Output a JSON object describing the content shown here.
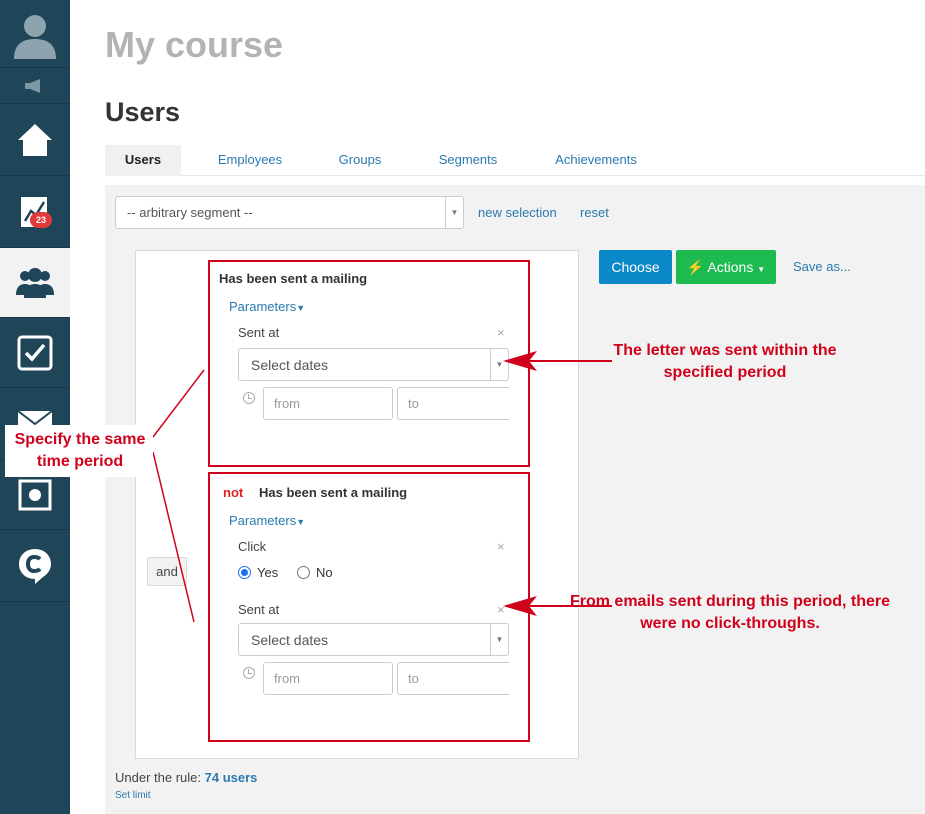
{
  "app": {
    "course_title": "My course",
    "page_title": "Users"
  },
  "sidebar": {
    "items": [
      {
        "icon": "user-avatar-icon"
      },
      {
        "icon": "megaphone-icon"
      },
      {
        "icon": "home-icon"
      },
      {
        "icon": "chart-icon",
        "badge": "23"
      },
      {
        "icon": "users-icon",
        "active": true
      },
      {
        "icon": "checkbox-icon"
      },
      {
        "icon": "mail-icon"
      },
      {
        "icon": "safe-icon"
      },
      {
        "icon": "chat-logo-icon"
      }
    ]
  },
  "tabs": [
    {
      "label": "Users",
      "active": true
    },
    {
      "label": "Employees"
    },
    {
      "label": "Groups"
    },
    {
      "label": "Segments"
    },
    {
      "label": "Achievements"
    }
  ],
  "segment": {
    "selected": "-- arbitrary segment --",
    "new_selection": "new selection",
    "reset": "reset"
  },
  "actions": {
    "choose": "Choose",
    "actions": "Actions",
    "save_as": "Save as..."
  },
  "conditions": {
    "and_label": "and",
    "first": {
      "title": "Has been sent a mailing",
      "params_label": "Parameters",
      "sent_at_label": "Sent at",
      "dates_placeholder": "Select dates",
      "from_placeholder": "from",
      "to_placeholder": "to"
    },
    "second": {
      "not_label": "not",
      "title": "Has been sent a mailing",
      "params_label": "Parameters",
      "click_label": "Click",
      "yes_label": "Yes",
      "no_label": "No",
      "click_value": "Yes",
      "sent_at_label": "Sent at",
      "dates_placeholder": "Select dates",
      "from_placeholder": "from",
      "to_placeholder": "to"
    }
  },
  "footer": {
    "rule_prefix": "Under the rule:",
    "rule_count": "74 users",
    "set_limit": "Set limit"
  },
  "annotations": {
    "left": "Specify the same time period",
    "top_right": "The letter was sent within the specified period",
    "bottom_right": "From emails sent during this period, there were no click-throughs.",
    "color": "#d0021b"
  },
  "colors": {
    "sidebar": "#1f4558",
    "link": "#2a7ab0",
    "choose_btn": "#0a88c7",
    "actions_btn": "#1dbb4f",
    "highlight": "#d0021b"
  }
}
